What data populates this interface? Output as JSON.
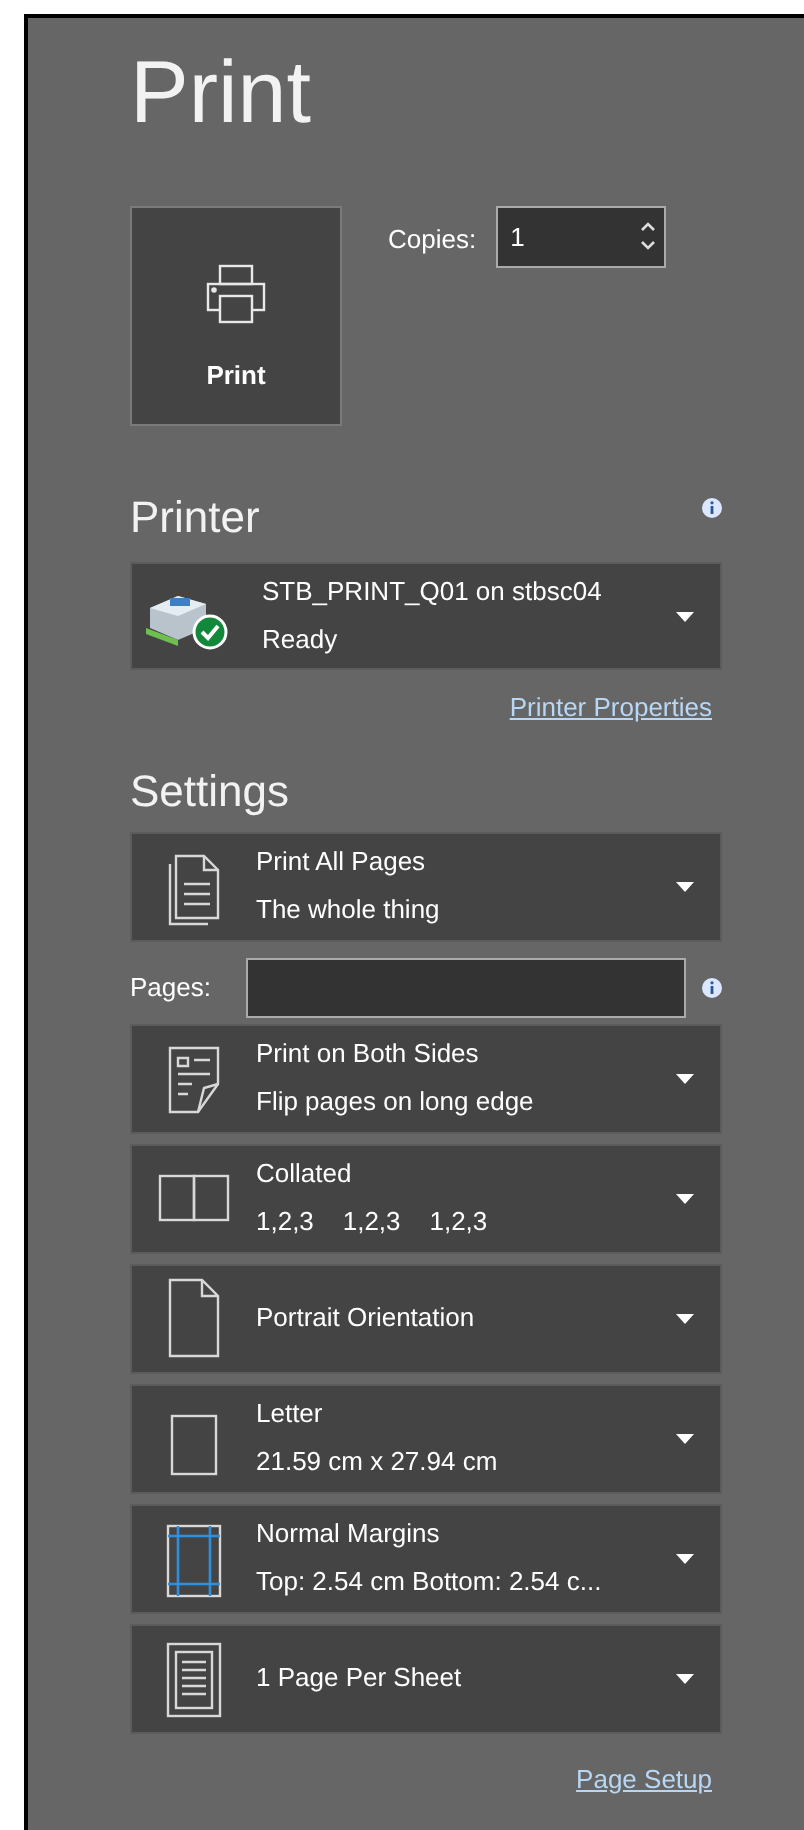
{
  "title": "Print",
  "print_button": {
    "label": "Print"
  },
  "copies": {
    "label": "Copies:",
    "value": "1"
  },
  "printer": {
    "heading": "Printer",
    "name": "STB_PRINT_Q01 on stbsc04",
    "status": "Ready",
    "properties_link": "Printer Properties"
  },
  "settings": {
    "heading": "Settings",
    "options": [
      {
        "title": "Print All Pages",
        "detail": "The whole thing"
      },
      {
        "kind": "pages_field",
        "label": "Pages:"
      },
      {
        "title": "Print on Both Sides",
        "detail": "Flip pages on long edge"
      },
      {
        "title": "Collated",
        "detail": "1,2,3    1,2,3    1,2,3"
      },
      {
        "title": "Portrait Orientation"
      },
      {
        "title": "Letter",
        "detail": "21.59 cm x 27.94 cm"
      },
      {
        "title": "Normal Margins",
        "detail": "Top: 2.54 cm Bottom: 2.54 c..."
      },
      {
        "title": "1 Page Per Sheet"
      }
    ],
    "page_setup_link": "Page Setup"
  }
}
